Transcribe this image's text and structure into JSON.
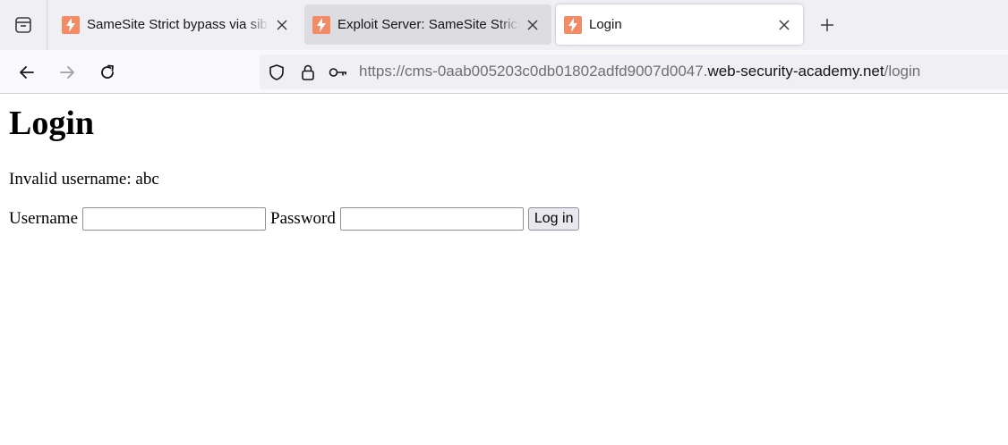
{
  "browser": {
    "tabs": [
      {
        "title": "SameSite Strict bypass via sibling domain",
        "active": false
      },
      {
        "title": "Exploit Server: SameSite Strict bypass",
        "active": false
      },
      {
        "title": "Login",
        "active": true
      }
    ],
    "url": {
      "prefix": "https://cms-0aab005203c0db01802adfd9007d0047.",
      "host": "web-security-academy.net",
      "path": "/login"
    }
  },
  "page": {
    "heading": "Login",
    "message": "Invalid username: abc",
    "username_label": "Username",
    "username_value": "",
    "password_label": "Password",
    "password_value": "",
    "submit_label": "Log in"
  },
  "colors": {
    "favicon": "#f28c66",
    "tabstrip_bg": "#f0f0f4",
    "navbar_bg": "#f9f9fb"
  }
}
